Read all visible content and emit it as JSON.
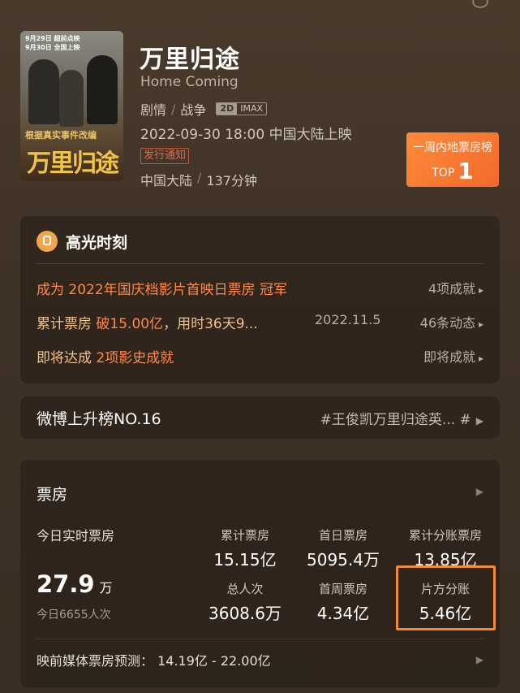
{
  "movie": {
    "title": "万里归途",
    "subtitle": "Home Coming",
    "genres": [
      "剧情",
      "战争"
    ],
    "formats": [
      "2D",
      "IMAX"
    ],
    "release": "2022-09-30 18:00 中国大陆上映",
    "notice": "发行通知",
    "region": "中国大陆",
    "duration": "137分钟"
  },
  "poster": {
    "date_line_1": "9月29日 超前点映",
    "date_line_2": "9月30日 全国上映",
    "tagline": "根据真实事件改编",
    "title": "万里归途"
  },
  "rank_badge": {
    "label": "一周内地票房榜",
    "prefix": "TOP",
    "rank": "1"
  },
  "highlights": {
    "title": "高光时刻",
    "row1": {
      "pre": "成为 ",
      "hl": "2022年国庆档影片首映日票房",
      "post": " 冠军",
      "link": "4项成就"
    },
    "row2": {
      "pre": "累计票房 ",
      "hl": "破15.00亿",
      "post": "，用时36天9...",
      "date": "2022.11.5",
      "link": "46条动态"
    },
    "row3": {
      "pre": "即将达成 ",
      "hl": "2项影史成就",
      "link": "即将成就"
    }
  },
  "weibo": {
    "rank": "微博上升榜NO.16",
    "tag": "#王俊凯万里归途英...",
    "hash": "#"
  },
  "box_office": {
    "title": "票房",
    "today_label": "今日实时票房",
    "today_value": "27.9",
    "today_unit": "万",
    "today_sub": "今日6655人次",
    "stats": [
      {
        "label": "累计票房",
        "value": "15.15亿"
      },
      {
        "label": "首日票房",
        "value": "5095.4万"
      },
      {
        "label": "累计分账票房",
        "value": "13.85亿"
      },
      {
        "label": "总人次",
        "value": "3608.6万"
      },
      {
        "label": "首周票房",
        "value": "4.34亿"
      },
      {
        "label": "片方分账",
        "value": "5.46亿"
      }
    ],
    "forecast": "映前媒体票房预测： 14.19亿 - 22.00亿"
  },
  "colors": {
    "accent_orange": "#ff8a4a",
    "badge_orange": "#f26a2a",
    "highlight_box": "#f08a35"
  }
}
